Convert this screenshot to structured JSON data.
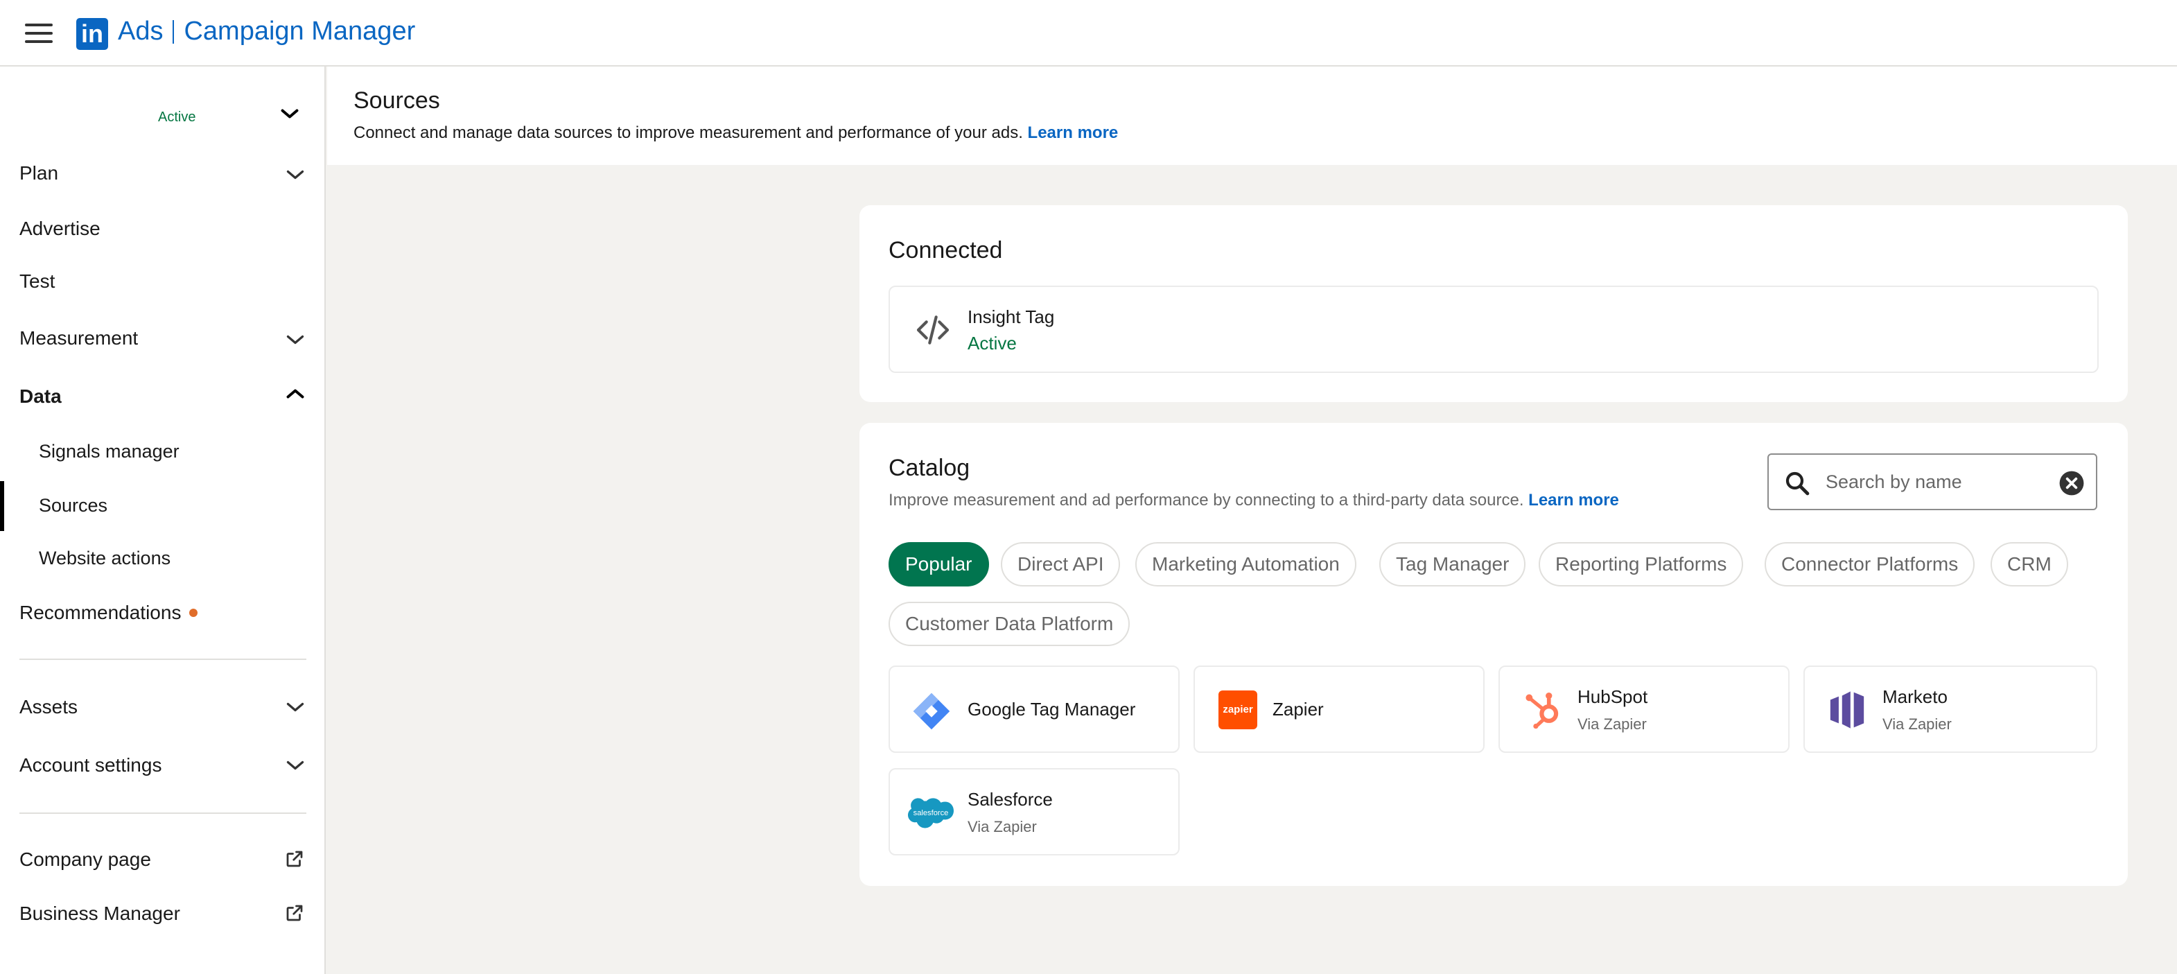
{
  "header": {
    "logo_text": "in",
    "product": "Ads",
    "app_name": "Campaign Manager"
  },
  "sidebar": {
    "account_status": "Active",
    "items": {
      "plan": "Plan",
      "advertise": "Advertise",
      "test": "Test",
      "measurement": "Measurement",
      "data": "Data",
      "signals_manager": "Signals manager",
      "sources": "Sources",
      "website_actions": "Website actions",
      "recommendations": "Recommendations",
      "assets": "Assets",
      "account_settings": "Account settings",
      "company_page": "Company page",
      "business_manager": "Business Manager"
    }
  },
  "page": {
    "title": "Sources",
    "description": "Connect and manage data sources to improve measurement and performance of your ads.",
    "learn_more": "Learn more"
  },
  "connected": {
    "title": "Connected",
    "item": {
      "name": "Insight Tag",
      "status": "Active",
      "icon": "code-icon"
    }
  },
  "catalog": {
    "title": "Catalog",
    "description": "Improve measurement and ad performance by connecting to a third-party data source.",
    "learn_more": "Learn more",
    "search_placeholder": "Search by name",
    "filters": [
      "Popular",
      "Direct API",
      "Marketing Automation",
      "Tag Manager",
      "Reporting Platforms",
      "Connector Platforms",
      "CRM",
      "Customer Data Platform"
    ],
    "selected_filter": "Popular",
    "sources": [
      {
        "name": "Google Tag Manager",
        "sub": ""
      },
      {
        "name": "Zapier",
        "sub": "",
        "logo_text": "zapier"
      },
      {
        "name": "HubSpot",
        "sub": "Via Zapier"
      },
      {
        "name": "Marketo",
        "sub": "Via Zapier"
      },
      {
        "name": "Salesforce",
        "sub": "Via Zapier",
        "logo_text": "salesforce"
      }
    ]
  },
  "colors": {
    "brand_blue": "#0a66c2",
    "active_green": "#057642",
    "pill_selected": "#01754f",
    "notification_dot": "#e06d2a",
    "zapier_orange": "#ff4f00",
    "hubspot_orange": "#ff7a59",
    "marketo_purple": "#5c4c9f",
    "salesforce_blue": "#1798c1"
  }
}
